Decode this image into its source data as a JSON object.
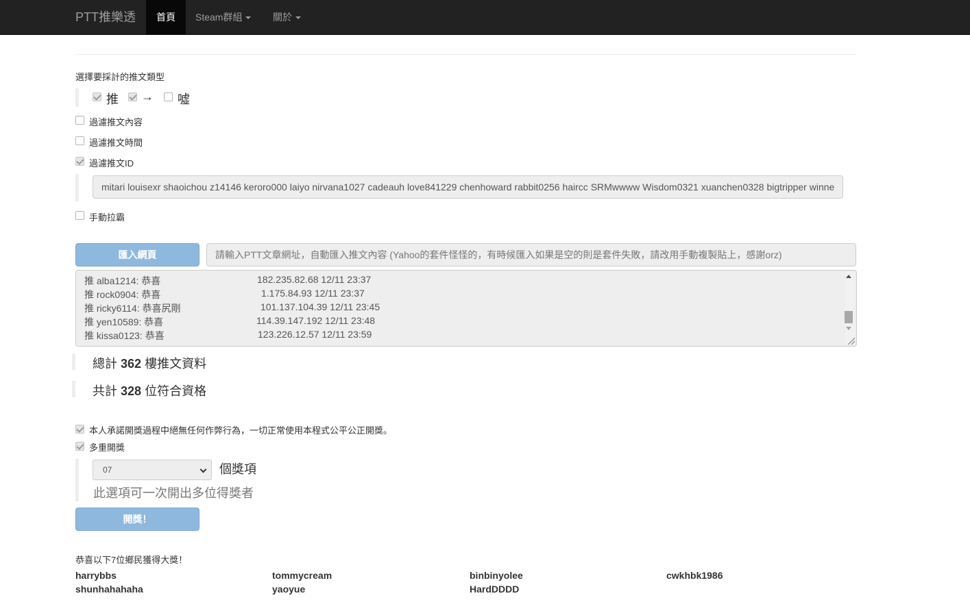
{
  "navbar": {
    "brand": "PTT推樂透",
    "items": [
      {
        "label": "首頁",
        "active": true
      },
      {
        "label": "Steam群組",
        "dropdown": true
      },
      {
        "label": "關於",
        "dropdown": true
      }
    ]
  },
  "push_types": {
    "heading": "選擇要採計的推文類型",
    "options": [
      {
        "label": "推",
        "checked": true
      },
      {
        "label": "→",
        "checked": true
      },
      {
        "label": "噓",
        "checked": false
      }
    ]
  },
  "filters": {
    "content": {
      "label": "過濾推文內容",
      "checked": false
    },
    "time": {
      "label": "過濾推文時間",
      "checked": false
    },
    "id": {
      "label": "過濾推文ID",
      "checked": true,
      "value": "mitari louisexr shaoichou z14146 keroro000 laiyo nirvana1027 cadeauh love841229 chenhoward rabbit0256 haircc SRMwwww Wisdom0321 xuanchen0328 bigtripper winne"
    },
    "manual": {
      "label": "手動拉霸",
      "checked": false
    }
  },
  "import": {
    "button_label": "匯入網頁",
    "url_placeholder": "請輸入PTT文章網址，自動匯入推文內容 (Yahoo的套件怪怪的，有時候匯入如果是空的則是套件失敗，請改用手動複製貼上，感謝orz)"
  },
  "push_list": [
    {
      "text": "推 alba1214: 恭喜",
      "ip": "182.235.82.68 12/11 23:37"
    },
    {
      "text": "推 rock0904: 恭喜",
      "ip": "1.175.84.93 12/11 23:37"
    },
    {
      "text": "推 ricky6114: 恭喜尻剛",
      "ip": "101.137.104.39 12/11 23:45"
    },
    {
      "text": "推 yen10589: 恭喜",
      "ip": "114.39.147.192 12/11 23:48"
    },
    {
      "text": "推 kissa0123: 恭喜",
      "ip": "123.226.12.57 12/11 23:59"
    }
  ],
  "stats": {
    "total_prefix": "總計",
    "total_count": "362",
    "total_suffix": "樓推文資料",
    "eligible_prefix": "共計",
    "eligible_count": "328",
    "eligible_suffix": "位符合資格"
  },
  "commit": {
    "pledge": {
      "label": "本人承諾開獎過程中絕無任何作弊行為，一切正常使用本程式公平公正開獎。",
      "checked": true
    },
    "multi": {
      "label": "多重開獎",
      "checked": true
    },
    "prize_count": "07",
    "prize_suffix": "個獎項",
    "prize_hint": "此選項可一次開出多位得獎者",
    "draw_button": "開獎！"
  },
  "results": {
    "heading": "恭喜以下7位鄉民獲得大獎！",
    "winners": [
      "harrybbs",
      "tommycream",
      "binbinyolee",
      "cwkhbk1986",
      "shunhahahaha",
      "yaoyue",
      "HardDDDD"
    ]
  }
}
